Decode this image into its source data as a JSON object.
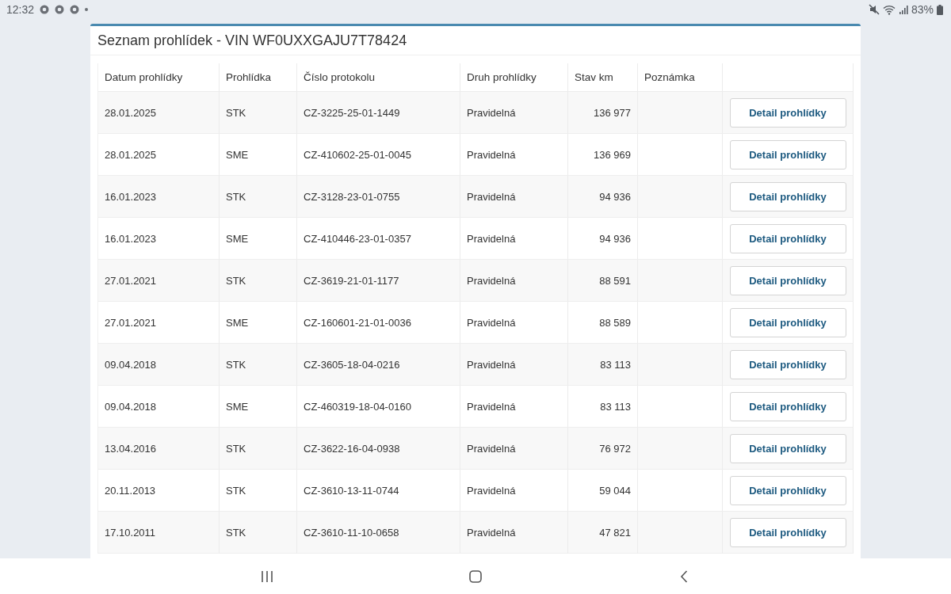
{
  "status_bar": {
    "time": "12:32",
    "battery": "83%"
  },
  "title": "Seznam prohlídek - VIN WF0UXXGAJU7T78424",
  "table": {
    "columns": [
      "Datum prohlídky",
      "Prohlídka",
      "Číslo protokolu",
      "Druh prohlídky",
      "Stav km",
      "Poznámka"
    ],
    "rows": [
      {
        "date": "28.01.2025",
        "type": "STK",
        "protocol": "CZ-3225-25-01-1449",
        "kind": "Pravidelná",
        "km": "136 977",
        "button": "Detail prohlídky"
      },
      {
        "date": "28.01.2025",
        "type": "SME",
        "protocol": "CZ-410602-25-01-0045",
        "kind": "Pravidelná",
        "km": "136 969",
        "button": "Detail prohlídky"
      },
      {
        "date": "16.01.2023",
        "type": "STK",
        "protocol": "CZ-3128-23-01-0755",
        "kind": "Pravidelná",
        "km": "94 936",
        "button": "Detail prohlídky"
      },
      {
        "date": "16.01.2023",
        "type": "SME",
        "protocol": "CZ-410446-23-01-0357",
        "kind": "Pravidelná",
        "km": "94 936",
        "button": "Detail prohlídky"
      },
      {
        "date": "27.01.2021",
        "type": "STK",
        "protocol": "CZ-3619-21-01-1177",
        "kind": "Pravidelná",
        "km": "88 591",
        "button": "Detail prohlídky"
      },
      {
        "date": "27.01.2021",
        "type": "SME",
        "protocol": "CZ-160601-21-01-0036",
        "kind": "Pravidelná",
        "km": "88 589",
        "button": "Detail prohlídky"
      },
      {
        "date": "09.04.2018",
        "type": "STK",
        "protocol": "CZ-3605-18-04-0216",
        "kind": "Pravidelná",
        "km": "83 113",
        "button": "Detail prohlídky"
      },
      {
        "date": "09.04.2018",
        "type": "SME",
        "protocol": "CZ-460319-18-04-0160",
        "kind": "Pravidelná",
        "km": "83 113",
        "button": "Detail prohlídky"
      },
      {
        "date": "13.04.2016",
        "type": "STK",
        "protocol": "CZ-3622-16-04-0938",
        "kind": "Pravidelná",
        "km": "76 972",
        "button": "Detail prohlídky"
      },
      {
        "date": "20.11.2013",
        "type": "STK",
        "protocol": "CZ-3610-13-11-0744",
        "kind": "Pravidelná",
        "km": "59 044",
        "button": "Detail prohlídky"
      },
      {
        "date": "17.10.2011",
        "type": "STK",
        "protocol": "CZ-3610-11-10-0658",
        "kind": "Pravidelná",
        "km": "47 821",
        "button": "Detail prohlídky"
      }
    ]
  }
}
